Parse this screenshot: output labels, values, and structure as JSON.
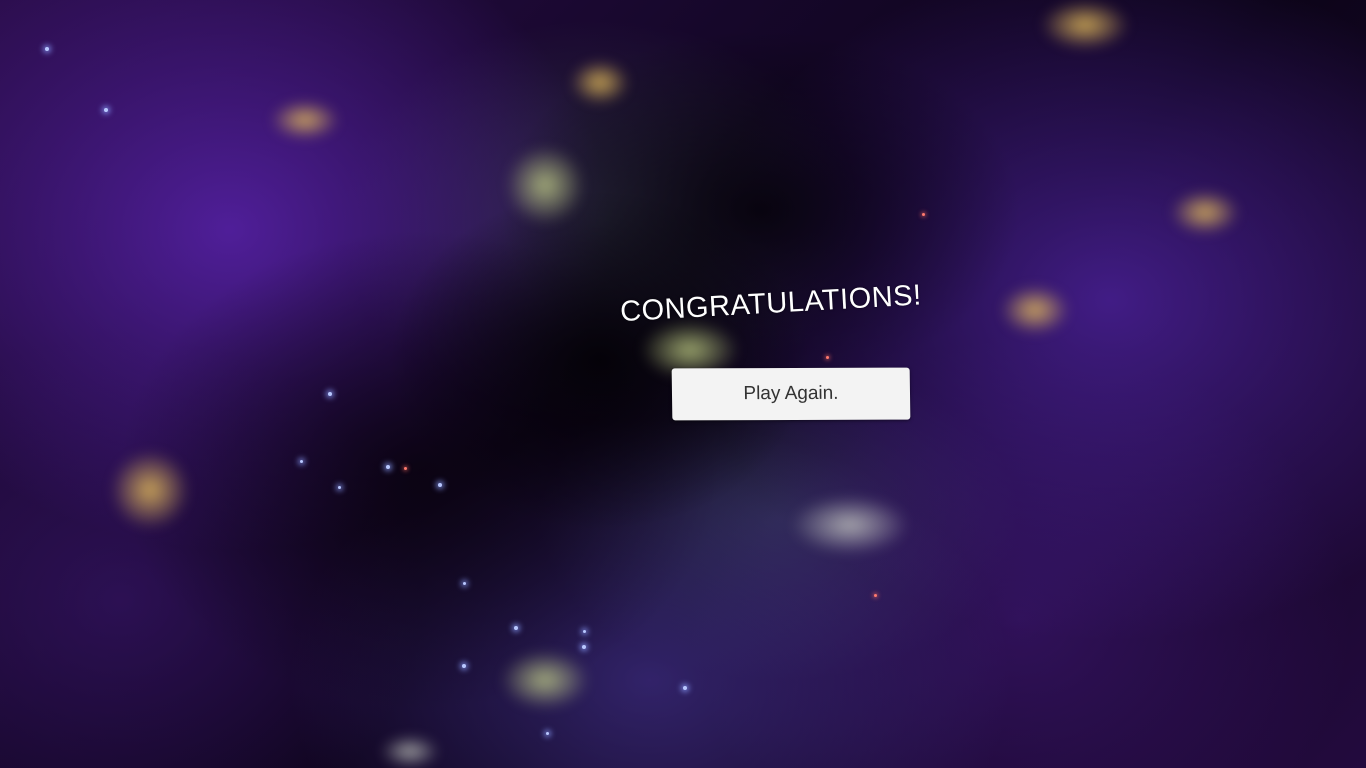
{
  "screen": {
    "title": "CONGRATULATIONS!",
    "button_label": "Play Again."
  },
  "colors": {
    "nebula_purple": "#5822aa",
    "nebula_dark": "#0c0418",
    "nebula_gold": "#e6be5a",
    "button_bg": "#f3f3f3",
    "button_text": "#333333",
    "title_text": "#ffffff"
  }
}
